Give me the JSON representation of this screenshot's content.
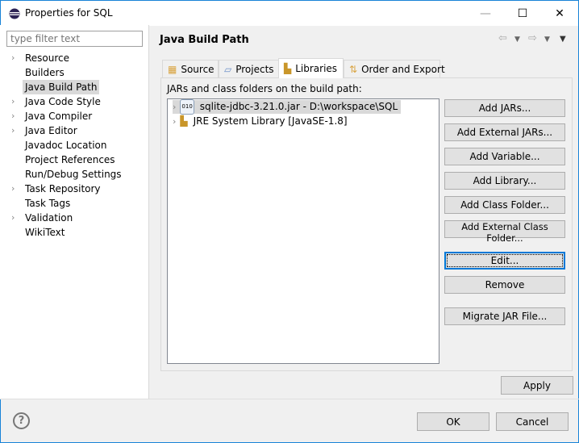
{
  "window": {
    "title": "Properties for SQL",
    "minimize": "—",
    "maximize": "☐",
    "close": "✕"
  },
  "sidebar": {
    "filter_placeholder": "type filter text",
    "items": [
      {
        "label": "Resource",
        "expandable": true
      },
      {
        "label": "Builders",
        "expandable": false
      },
      {
        "label": "Java Build Path",
        "expandable": false,
        "selected": true
      },
      {
        "label": "Java Code Style",
        "expandable": true
      },
      {
        "label": "Java Compiler",
        "expandable": true
      },
      {
        "label": "Java Editor",
        "expandable": true
      },
      {
        "label": "Javadoc Location",
        "expandable": false
      },
      {
        "label": "Project References",
        "expandable": false
      },
      {
        "label": "Run/Debug Settings",
        "expandable": false
      },
      {
        "label": "Task Repository",
        "expandable": true
      },
      {
        "label": "Task Tags",
        "expandable": false
      },
      {
        "label": "Validation",
        "expandable": true
      },
      {
        "label": "WikiText",
        "expandable": false
      }
    ]
  },
  "header": {
    "title": "Java Build Path"
  },
  "tabs": [
    {
      "label": "Source",
      "icon": "source-folder-icon"
    },
    {
      "label": "Projects",
      "icon": "folder-icon"
    },
    {
      "label": "Libraries",
      "icon": "library-icon",
      "selected": true
    },
    {
      "label": "Order and Export",
      "icon": "order-icon"
    }
  ],
  "libraries": {
    "label": "JARs and class folders on the build path:",
    "entries": [
      {
        "label": "sqlite-jdbc-3.21.0.jar - D:\\workspace\\SQL",
        "icon": "jar-icon",
        "selected": true
      },
      {
        "label": "JRE System Library [JavaSE-1.8]",
        "icon": "library-icon"
      }
    ],
    "buttons": [
      "Add JARs...",
      "Add External JARs...",
      "Add Variable...",
      "Add Library...",
      "Add Class Folder...",
      "Add External Class Folder...",
      "Edit...",
      "Remove",
      "Migrate JAR File..."
    ]
  },
  "footer": {
    "apply": "Apply",
    "ok": "OK",
    "cancel": "Cancel",
    "help": "?"
  },
  "colors": {
    "accent": "#0078d7",
    "selection": "#d9d9d9"
  }
}
